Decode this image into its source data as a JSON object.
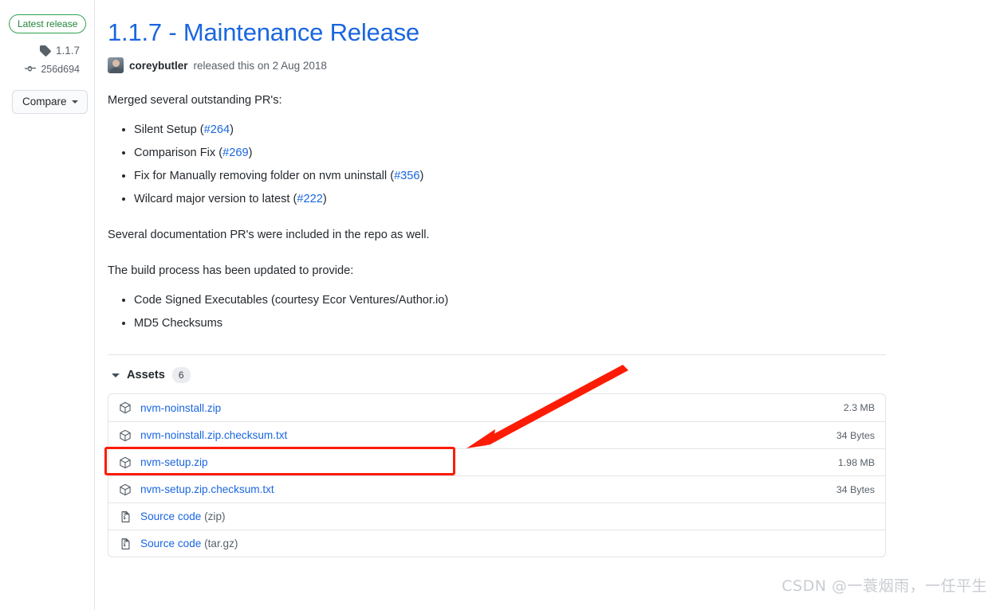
{
  "sidebar": {
    "latest_badge": "Latest release",
    "tag": "1.1.7",
    "commit": "256d694",
    "compare_label": "Compare",
    "tag_icon": "tag-icon",
    "commit_icon": "commit-icon",
    "caret_icon": "chevron-down-icon"
  },
  "release": {
    "title": "1.1.7 - Maintenance Release",
    "author": "coreybutler",
    "released_text": "released this on 2 Aug 2018",
    "avatar": "avatar"
  },
  "body": {
    "intro": "Merged several outstanding PR's:",
    "pr_list": [
      {
        "text": "Silent Setup (",
        "link": "#264",
        "after": ")"
      },
      {
        "text": "Comparison Fix (",
        "link": "#269",
        "after": ")"
      },
      {
        "text": "Fix for Manually removing folder on nvm uninstall (",
        "link": "#356",
        "after": ")"
      },
      {
        "text": "Wilcard major version to latest (",
        "link": "#222",
        "after": ")"
      }
    ],
    "para_docs": "Several documentation PR's were included in the repo as well.",
    "para_build": "The build process has been updated to provide:",
    "build_list": [
      "Code Signed Executables (courtesy Ecor Ventures/Author.io)",
      "MD5 Checksums"
    ]
  },
  "assets": {
    "label": "Assets",
    "count": "6",
    "toggle_icon": "triangle-down-icon",
    "rows": [
      {
        "name": "nvm-noinstall.zip",
        "suffix": "",
        "size": "2.3 MB",
        "icon": "package-icon"
      },
      {
        "name": "nvm-noinstall.zip.checksum.txt",
        "suffix": "",
        "size": "34 Bytes",
        "icon": "package-icon"
      },
      {
        "name": "nvm-setup.zip",
        "suffix": "",
        "size": "1.98 MB",
        "icon": "package-icon"
      },
      {
        "name": "nvm-setup.zip.checksum.txt",
        "suffix": "",
        "size": "34 Bytes",
        "icon": "package-icon"
      },
      {
        "name": "Source code",
        "suffix": " (zip)",
        "size": "",
        "icon": "file-zip-icon"
      },
      {
        "name": "Source code",
        "suffix": " (tar.gz)",
        "size": "",
        "icon": "file-zip-icon"
      }
    ]
  },
  "annotations": {
    "highlight_color": "#fc1c05",
    "arrow_color": "#fc1c05",
    "highlighted_row": "nvm-setup.zip"
  },
  "watermark": {
    "text": "CSDN @一蓑烟雨，一任平生"
  },
  "colors": {
    "link": "#1a66e0",
    "title": "#1a66e0",
    "green_badge": "#2ea44f",
    "text": "#24292e",
    "muted": "#586069",
    "border": "#e1e4e8"
  }
}
